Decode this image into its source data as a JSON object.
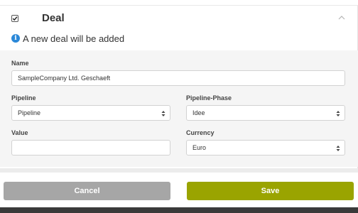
{
  "header": {
    "title": "Deal",
    "checked": true
  },
  "info": {
    "text": "A new deal will be added"
  },
  "form": {
    "name_label": "Name",
    "name_value": "SampleCompany Ltd. Geschaeft",
    "pipeline_label": "Pipeline",
    "pipeline_value": "Pipeline",
    "phase_label": "Pipeline-Phase",
    "phase_value": "Idee",
    "value_label": "Value",
    "value_value": "",
    "currency_label": "Currency",
    "currency_value": "Euro"
  },
  "footer": {
    "cancel_label": "Cancel",
    "save_label": "Save"
  },
  "colors": {
    "save": "#9aa400",
    "cancel": "#a6a6a6",
    "info_icon": "#2b88d8"
  }
}
